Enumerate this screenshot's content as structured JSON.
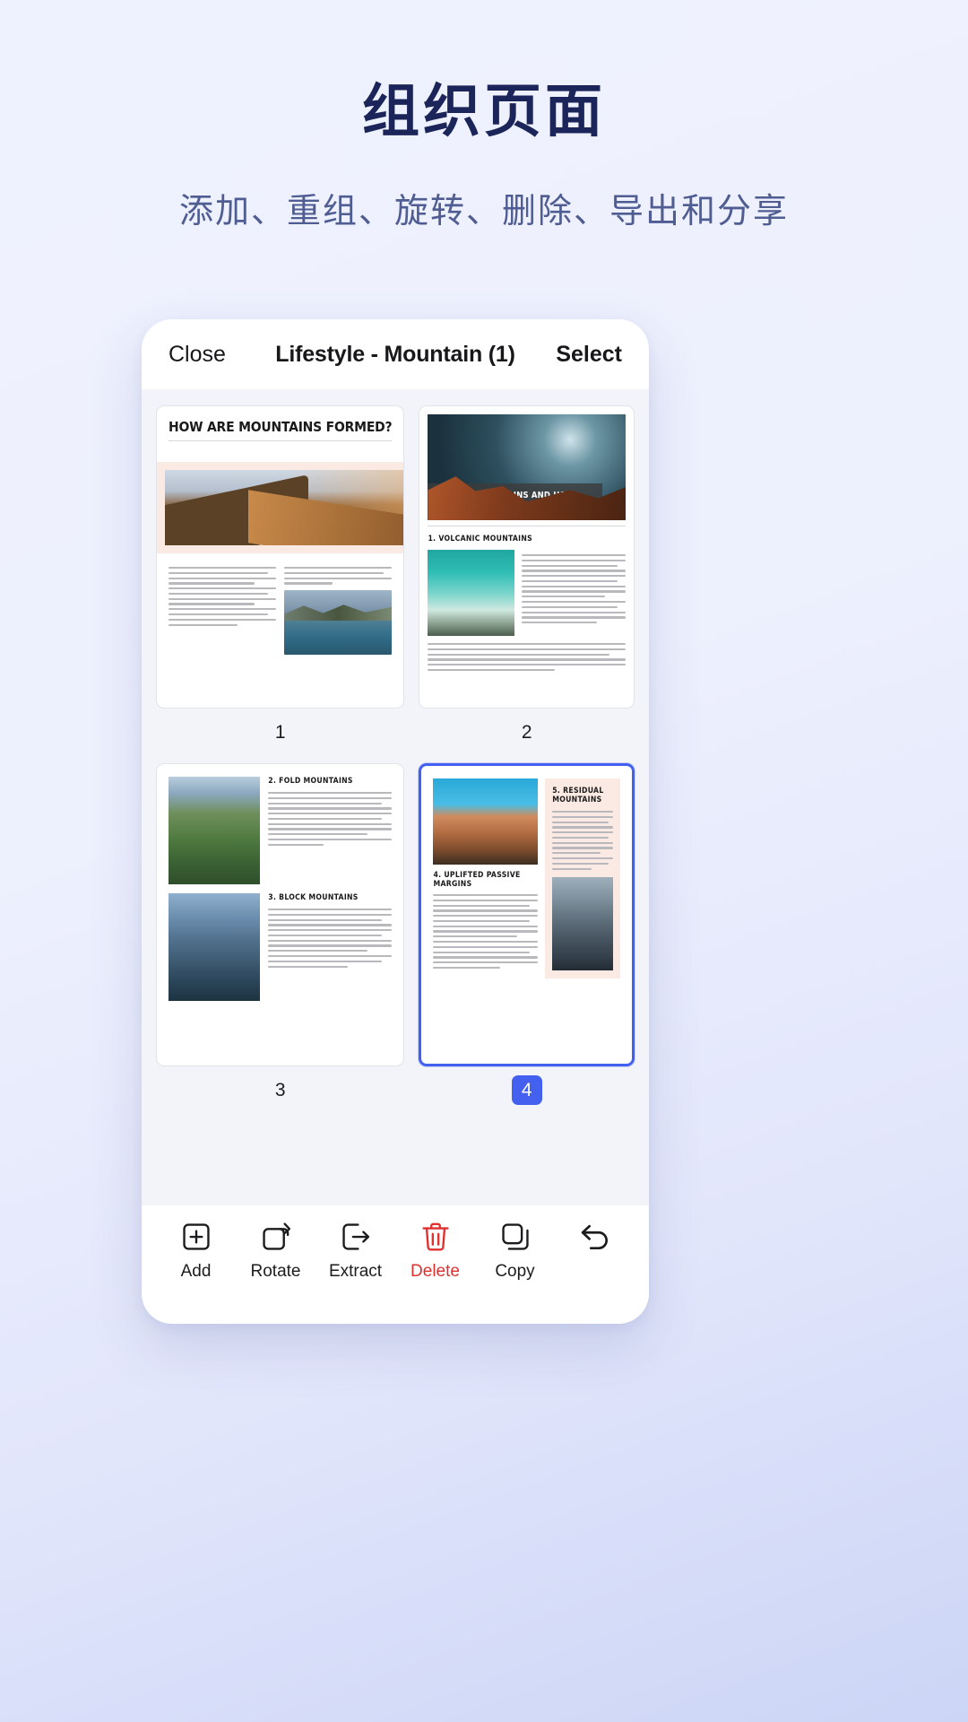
{
  "promo": {
    "title": "组织页面",
    "subtitle": "添加、重组、旋转、删除、导出和分享",
    "title_color": "#1b2559",
    "subtitle_color": "#4f5d92"
  },
  "appbar": {
    "close_label": "Close",
    "title": "Lifestyle - Mountain (1)",
    "select_label": "Select"
  },
  "accent_color": "#4361ee",
  "danger_color": "#e03131",
  "pages": [
    {
      "number": "1",
      "selected": false,
      "heading": "HOW ARE MOUNTAINS FORMED?",
      "body_preview": "Mountains are usually formed as a result of the movement of the earth's lithosphere. The lithosphere consists of the outer mantle and the crust which are also referred to as tectonic plates. The geological process of mountain formation involves many processes and activities which happened due to many forces acting together or in isolation."
    },
    {
      "number": "2",
      "selected": false,
      "heading": "TYPE OF MOUNTAINS AND HOW ARE THEY FORMED",
      "section": "1. VOLCANIC MOUNTAINS",
      "body_preview": "Volcanic mountains are formed as a result of movements in tectonic plates pushing up and down and against each other. The sudden random movement of the plate forces magma to the surface. The magma solidifies itself through a vent erupting on the earth's surface to form volcanic mountains."
    },
    {
      "number": "3",
      "selected": false,
      "heading": "2. FOLD MOUNTAINS",
      "heading2": "3. BLOCK MOUNTAINS",
      "body_preview": "Fold mountains are formed as a result of a collision between the tectonic plates. The plates then go through a geological process known as subduction. In the process, tectonic plates shift their original position by moving below one another and one is forced to sink in the mantle because of gravity.",
      "body_preview2": "Block mountains are formed as a result of a process known as faulting. When there are mass movements in the rocks, displacement is bound to occur. The displacement causes cracks between the rocks also known as fault lines."
    },
    {
      "number": "4",
      "selected": true,
      "heading": "4. UPLIFTED PASSIVE MARGINS",
      "heading2": "5. RESIDUAL MOUNTAINS",
      "body_preview": "Most mountains are formed through a sequence of geological process partly known as orogenesis. However, this is not the case with uplifted passive margins. There is no proper geophysical model that explains the formation of uplifted passive margins.",
      "body_preview2": "Residual mountains are created due to erosion in the uplifted area. When an uplift has occurred, the area can experience adverse weather conditions such as wind and semiarid which in turn can cause erosion."
    }
  ],
  "toolbar": [
    {
      "label": "Add",
      "icon": "add-page-icon",
      "danger": false
    },
    {
      "label": "Rotate",
      "icon": "rotate-icon",
      "danger": false
    },
    {
      "label": "Extract",
      "icon": "extract-icon",
      "danger": false
    },
    {
      "label": "Delete",
      "icon": "trash-icon",
      "danger": true
    },
    {
      "label": "Copy",
      "icon": "copy-icon",
      "danger": false
    },
    {
      "label": "",
      "icon": "undo-arrow-icon",
      "danger": false
    }
  ]
}
